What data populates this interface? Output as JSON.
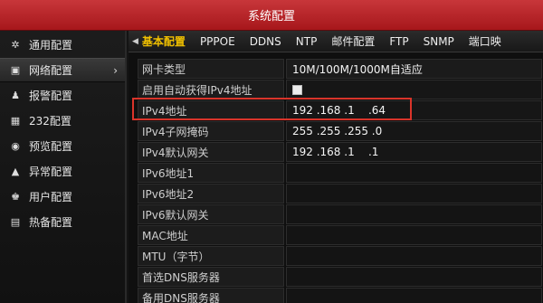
{
  "window": {
    "title": "系统配置"
  },
  "sidebar": {
    "items": [
      {
        "label": "通用配置",
        "icon": "gear-icon",
        "glyph": "✲"
      },
      {
        "label": "网络配置",
        "icon": "network-icon",
        "glyph": "▣",
        "active": true
      },
      {
        "label": "报警配置",
        "icon": "bell-icon",
        "glyph": "♟"
      },
      {
        "label": "232配置",
        "icon": "serial-port-icon",
        "glyph": "▦"
      },
      {
        "label": "预览配置",
        "icon": "eye-icon",
        "glyph": "◉"
      },
      {
        "label": "异常配置",
        "icon": "warning-icon",
        "glyph": "▲"
      },
      {
        "label": "用户配置",
        "icon": "users-icon",
        "glyph": "♚"
      },
      {
        "label": "热备配置",
        "icon": "hot-standby-icon",
        "glyph": "▤"
      }
    ]
  },
  "tabs": [
    "基本配置",
    "PPPOE",
    "DDNS",
    "NTP",
    "邮件配置",
    "FTP",
    "SNMP",
    "端口映"
  ],
  "form": {
    "nic_type": {
      "label": "网卡类型",
      "value": "10M/100M/1000M自适应"
    },
    "dhcp": {
      "label": "启用自动获得IPv4地址",
      "checked": false
    },
    "ipv4": {
      "label": "IPv4地址",
      "value": "192 .168 .1    .64"
    },
    "mask": {
      "label": "IPv4子网掩码",
      "value": "255 .255 .255 .0"
    },
    "gateway": {
      "label": "IPv4默认网关",
      "value": "192 .168 .1    .1"
    },
    "ipv6_1": {
      "label": "IPv6地址1",
      "value": ""
    },
    "ipv6_2": {
      "label": "IPv6地址2",
      "value": ""
    },
    "ipv6_gw": {
      "label": "IPv6默认网关",
      "value": ""
    },
    "mac": {
      "label": "MAC地址",
      "value": ""
    },
    "mtu": {
      "label": "MTU（字节）",
      "value": ""
    },
    "dns1": {
      "label": "首选DNS服务器",
      "value": ""
    },
    "dns2": {
      "label": "备用DNS服务器",
      "value": ""
    }
  },
  "colors": {
    "title_bar": "#b5242a",
    "active_tab": "#f0c000",
    "highlight_box": "#d9342a"
  }
}
